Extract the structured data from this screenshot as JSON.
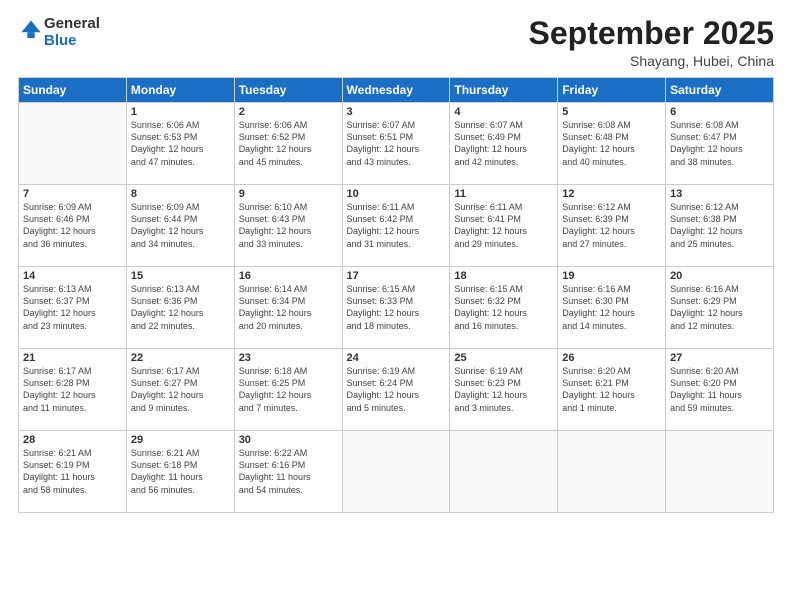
{
  "logo": {
    "general": "General",
    "blue": "Blue"
  },
  "title": "September 2025",
  "location": "Shayang, Hubei, China",
  "weekdays": [
    "Sunday",
    "Monday",
    "Tuesday",
    "Wednesday",
    "Thursday",
    "Friday",
    "Saturday"
  ],
  "weeks": [
    [
      {
        "day": "",
        "info": ""
      },
      {
        "day": "1",
        "info": "Sunrise: 6:06 AM\nSunset: 6:53 PM\nDaylight: 12 hours\nand 47 minutes."
      },
      {
        "day": "2",
        "info": "Sunrise: 6:06 AM\nSunset: 6:52 PM\nDaylight: 12 hours\nand 45 minutes."
      },
      {
        "day": "3",
        "info": "Sunrise: 6:07 AM\nSunset: 6:51 PM\nDaylight: 12 hours\nand 43 minutes."
      },
      {
        "day": "4",
        "info": "Sunrise: 6:07 AM\nSunset: 6:49 PM\nDaylight: 12 hours\nand 42 minutes."
      },
      {
        "day": "5",
        "info": "Sunrise: 6:08 AM\nSunset: 6:48 PM\nDaylight: 12 hours\nand 40 minutes."
      },
      {
        "day": "6",
        "info": "Sunrise: 6:08 AM\nSunset: 6:47 PM\nDaylight: 12 hours\nand 38 minutes."
      }
    ],
    [
      {
        "day": "7",
        "info": "Sunrise: 6:09 AM\nSunset: 6:46 PM\nDaylight: 12 hours\nand 36 minutes."
      },
      {
        "day": "8",
        "info": "Sunrise: 6:09 AM\nSunset: 6:44 PM\nDaylight: 12 hours\nand 34 minutes."
      },
      {
        "day": "9",
        "info": "Sunrise: 6:10 AM\nSunset: 6:43 PM\nDaylight: 12 hours\nand 33 minutes."
      },
      {
        "day": "10",
        "info": "Sunrise: 6:11 AM\nSunset: 6:42 PM\nDaylight: 12 hours\nand 31 minutes."
      },
      {
        "day": "11",
        "info": "Sunrise: 6:11 AM\nSunset: 6:41 PM\nDaylight: 12 hours\nand 29 minutes."
      },
      {
        "day": "12",
        "info": "Sunrise: 6:12 AM\nSunset: 6:39 PM\nDaylight: 12 hours\nand 27 minutes."
      },
      {
        "day": "13",
        "info": "Sunrise: 6:12 AM\nSunset: 6:38 PM\nDaylight: 12 hours\nand 25 minutes."
      }
    ],
    [
      {
        "day": "14",
        "info": "Sunrise: 6:13 AM\nSunset: 6:37 PM\nDaylight: 12 hours\nand 23 minutes."
      },
      {
        "day": "15",
        "info": "Sunrise: 6:13 AM\nSunset: 6:36 PM\nDaylight: 12 hours\nand 22 minutes."
      },
      {
        "day": "16",
        "info": "Sunrise: 6:14 AM\nSunset: 6:34 PM\nDaylight: 12 hours\nand 20 minutes."
      },
      {
        "day": "17",
        "info": "Sunrise: 6:15 AM\nSunset: 6:33 PM\nDaylight: 12 hours\nand 18 minutes."
      },
      {
        "day": "18",
        "info": "Sunrise: 6:15 AM\nSunset: 6:32 PM\nDaylight: 12 hours\nand 16 minutes."
      },
      {
        "day": "19",
        "info": "Sunrise: 6:16 AM\nSunset: 6:30 PM\nDaylight: 12 hours\nand 14 minutes."
      },
      {
        "day": "20",
        "info": "Sunrise: 6:16 AM\nSunset: 6:29 PM\nDaylight: 12 hours\nand 12 minutes."
      }
    ],
    [
      {
        "day": "21",
        "info": "Sunrise: 6:17 AM\nSunset: 6:28 PM\nDaylight: 12 hours\nand 11 minutes."
      },
      {
        "day": "22",
        "info": "Sunrise: 6:17 AM\nSunset: 6:27 PM\nDaylight: 12 hours\nand 9 minutes."
      },
      {
        "day": "23",
        "info": "Sunrise: 6:18 AM\nSunset: 6:25 PM\nDaylight: 12 hours\nand 7 minutes."
      },
      {
        "day": "24",
        "info": "Sunrise: 6:19 AM\nSunset: 6:24 PM\nDaylight: 12 hours\nand 5 minutes."
      },
      {
        "day": "25",
        "info": "Sunrise: 6:19 AM\nSunset: 6:23 PM\nDaylight: 12 hours\nand 3 minutes."
      },
      {
        "day": "26",
        "info": "Sunrise: 6:20 AM\nSunset: 6:21 PM\nDaylight: 12 hours\nand 1 minute."
      },
      {
        "day": "27",
        "info": "Sunrise: 6:20 AM\nSunset: 6:20 PM\nDaylight: 11 hours\nand 59 minutes."
      }
    ],
    [
      {
        "day": "28",
        "info": "Sunrise: 6:21 AM\nSunset: 6:19 PM\nDaylight: 11 hours\nand 58 minutes."
      },
      {
        "day": "29",
        "info": "Sunrise: 6:21 AM\nSunset: 6:18 PM\nDaylight: 11 hours\nand 56 minutes."
      },
      {
        "day": "30",
        "info": "Sunrise: 6:22 AM\nSunset: 6:16 PM\nDaylight: 11 hours\nand 54 minutes."
      },
      {
        "day": "",
        "info": ""
      },
      {
        "day": "",
        "info": ""
      },
      {
        "day": "",
        "info": ""
      },
      {
        "day": "",
        "info": ""
      }
    ]
  ]
}
